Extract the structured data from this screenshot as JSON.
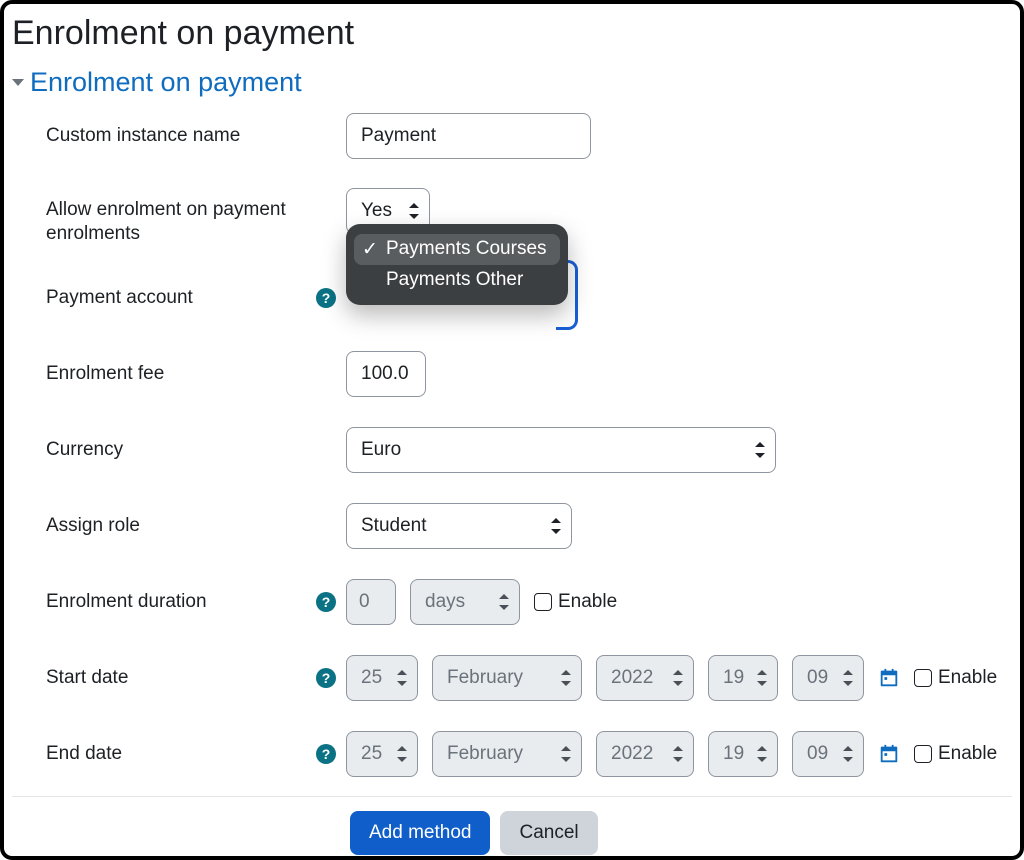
{
  "page": {
    "title": "Enrolment on payment"
  },
  "section": {
    "title": "Enrolment on payment"
  },
  "labels": {
    "custom_name": "Custom instance name",
    "allow_enrol": "Allow enrolment on payment enrolments",
    "payment_account": "Payment account",
    "fee": "Enrolment fee",
    "currency": "Currency",
    "assign_role": "Assign role",
    "duration": "Enrolment duration",
    "start_date": "Start date",
    "end_date": "End date",
    "enable": "Enable"
  },
  "values": {
    "custom_name": "Payment",
    "allow_enrol": "Yes",
    "fee": "100.0",
    "currency": "Euro",
    "assign_role": "Student",
    "duration_value": "0",
    "duration_unit": "days"
  },
  "payment_account": {
    "options": [
      "Payments Courses",
      "Payments Other"
    ],
    "selected": "Payments Courses"
  },
  "start_date": {
    "day": "25",
    "month": "February",
    "year": "2022",
    "hour": "19",
    "minute": "09",
    "enabled": false
  },
  "end_date": {
    "day": "25",
    "month": "February",
    "year": "2022",
    "hour": "19",
    "minute": "09",
    "enabled": false
  },
  "buttons": {
    "submit": "Add method",
    "cancel": "Cancel"
  },
  "help_glyph": "?"
}
